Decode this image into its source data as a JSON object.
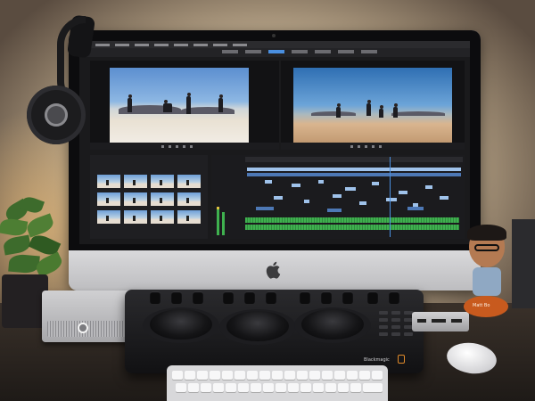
{
  "scene": {
    "panel_brand": "Blackmagic",
    "figurine_label": "Matt Bo",
    "colors": {
      "wall_glow": "#fbe9c9",
      "timeline_accent": "#4a8fe0",
      "audio_wave": "#3fb14f",
      "sky_blue": "#5c8fd0",
      "desk": "#2a2622"
    },
    "icons": [
      "apple-logo",
      "headphones",
      "g-drive-logo",
      "blackmagic-logo"
    ]
  }
}
